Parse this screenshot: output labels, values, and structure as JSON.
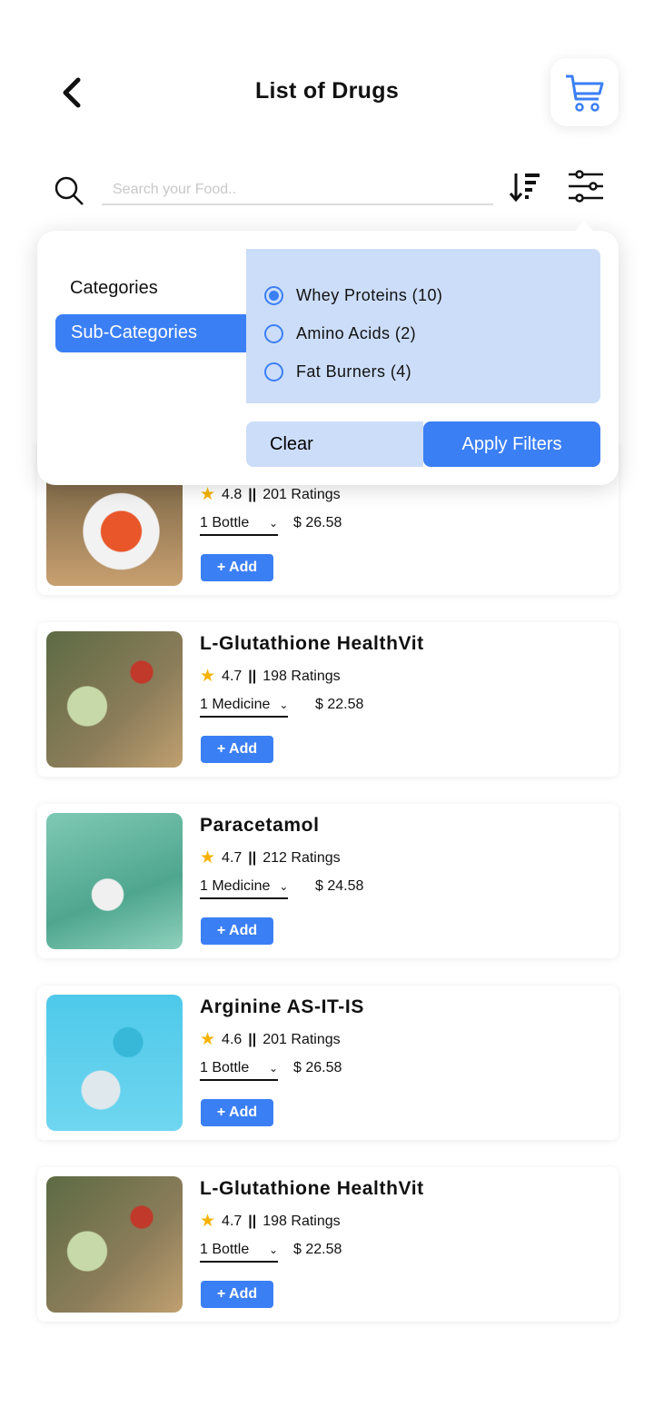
{
  "header": {
    "title": "List of Drugs",
    "back_icon": "chevron-left-icon",
    "cart_icon": "cart-icon"
  },
  "search": {
    "placeholder": "Search your Food..",
    "value": ""
  },
  "colors": {
    "accent": "#3B7FF5",
    "panel": "#CCDDF9",
    "star": "#F5B301"
  },
  "filter_popup": {
    "tabs": [
      {
        "label": "Categories",
        "active": false
      },
      {
        "label": "Sub-Categories",
        "active": true
      }
    ],
    "options": [
      {
        "label": "Whey Proteins (10)",
        "selected": true
      },
      {
        "label": "Amino Acids (2)",
        "selected": false
      },
      {
        "label": "Fat Burners (4)",
        "selected": false
      }
    ],
    "clear_label": "Clear",
    "apply_label": "Apply Filters"
  },
  "products": [
    {
      "name": "",
      "rating": "4.8",
      "separator": "||",
      "ratings": "201 Ratings",
      "qty": "1 Bottle",
      "price": "$ 26.58",
      "add": "+ Add"
    },
    {
      "name": "L-Glutathione HealthVit",
      "rating": "4.7",
      "separator": "||",
      "ratings": "198 Ratings",
      "qty": "1 Medicine",
      "price": "$ 22.58",
      "add": "+ Add"
    },
    {
      "name": "Paracetamol",
      "rating": "4.7",
      "separator": "||",
      "ratings": "212 Ratings",
      "qty": "1 Medicine",
      "price": "$ 24.58",
      "add": "+ Add"
    },
    {
      "name": "Arginine AS-IT-IS",
      "rating": "4.6",
      "separator": "||",
      "ratings": "201 Ratings",
      "qty": "1 Bottle",
      "price": "$ 26.58",
      "add": "+ Add"
    },
    {
      "name": "L-Glutathione HealthVit",
      "rating": "4.7",
      "separator": "||",
      "ratings": "198 Ratings",
      "qty": "1 Bottle",
      "price": "$ 22.58",
      "add": "+ Add"
    }
  ]
}
